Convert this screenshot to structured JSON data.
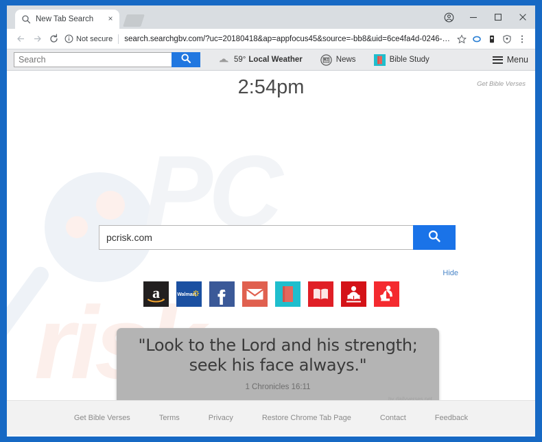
{
  "browser": {
    "tab": {
      "title": "New Tab Search",
      "favicon": "search-icon",
      "close": "×"
    },
    "new_tab_button": "new-tab-button",
    "window_controls": {
      "profile": "profile-avatar-icon",
      "minimize": "—",
      "maximize": "□",
      "close": "✕"
    },
    "nav": {
      "back": "←",
      "forward": "→",
      "reload": "⟳"
    },
    "omnibox": {
      "security_label": "Not secure",
      "security_icon": "info-circle-icon",
      "url": "search.searchgbv.com/?uc=20180418&ap=appfocus45&source=-bb8&uid=6ce4fa4d-0246-4ea3-a66e-b...",
      "url_domain": "search.searchgbv.com",
      "url_query": "/?uc=20180418&ap=appfocus45&source=-bb8&uid=6ce4fa4d-0246-4ea3-a66e-b...",
      "bookmark_icon": "star-icon",
      "extension_icons": [
        "oval-blue-icon",
        "dark-extension-icon",
        "shield-icon"
      ],
      "menu_icon": "three-dot-menu-icon"
    }
  },
  "hijacker_toolbar": {
    "search_placeholder": "Search",
    "search_value": "",
    "search_button_icon": "magnifier-icon",
    "weather": {
      "icon": "cloud-icon",
      "temperature": "59°",
      "label": "Local Weather"
    },
    "news": {
      "icon": "newspaper-icon",
      "label": "News"
    },
    "bible_study": {
      "icon": "bible-book-icon",
      "label": "Bible Study"
    },
    "menu": {
      "icon": "hamburger-icon",
      "label": "Menu"
    }
  },
  "page": {
    "clock": "2:54pm",
    "get_bible_verses_top": "Get Bible Verses",
    "search": {
      "value": "pcrisk.com",
      "placeholder": "",
      "button_icon": "magnifier-icon"
    },
    "hide_link": "Hide",
    "tiles": [
      {
        "name": "amazon",
        "label": "a",
        "bg": "#221f1f",
        "fg": "#ffffff"
      },
      {
        "name": "walmart",
        "label": "Walmart",
        "bg": "#1b50a1",
        "fg": "#ffffff"
      },
      {
        "name": "facebook",
        "label": "f",
        "bg": "#3b5998",
        "fg": "#ffffff"
      },
      {
        "name": "gmail",
        "label": "envelope",
        "bg": "#e0604f",
        "fg": "#ffffff"
      },
      {
        "name": "bible-book",
        "label": "book",
        "bg": "#1fbecd",
        "fg": "#e46a5e"
      },
      {
        "name": "open-bible",
        "label": "open-book",
        "bg": "#e01f26",
        "fg": "#fde4e4"
      },
      {
        "name": "bible-reader",
        "label": "reader",
        "bg": "#d41217",
        "fg": "#ffffff"
      },
      {
        "name": "bible-study-person",
        "label": "kneeling-reader",
        "bg": "#f42a2f",
        "fg": "#ffffff"
      }
    ],
    "verse": {
      "text": "\"Look to the Lord and his strength; seek his face always.\"",
      "reference": "1 Chronicles 16:11",
      "credit": "by dailyverses.net"
    },
    "watermark": {
      "part1": "PC",
      "part2": "risk"
    },
    "footer_links": [
      "Get Bible Verses",
      "Terms",
      "Privacy",
      "Restore Chrome Tab Page",
      "Contact",
      "Feedback"
    ]
  },
  "colors": {
    "frame_blue": "#1769c4",
    "accent_blue": "#1a73e8",
    "toolbar_bg": "#e9eaec",
    "verse_box": "#b4b4b4",
    "link_blue": "#4a86c8"
  }
}
